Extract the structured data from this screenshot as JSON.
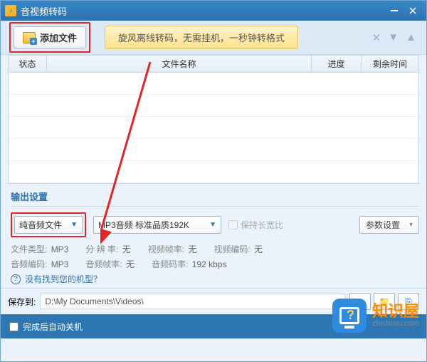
{
  "titlebar": {
    "title": "音视频转码"
  },
  "toolbar": {
    "add_label": "添加文件",
    "banner": "旋风离线转码，无需挂机，一秒钟转格式"
  },
  "table": {
    "headers": {
      "status": "状态",
      "name": "文件名称",
      "progress": "进度",
      "remain": "剩余时间"
    }
  },
  "output": {
    "section_title": "输出设置",
    "type_select": "纯音频文件",
    "format_select": "MP3音频 标准品质192K",
    "keep_ratio": "保持长宽比",
    "param_btn": "参数设置",
    "meta": {
      "file_type_lbl": "文件类型:",
      "file_type": "MP3",
      "resolution_lbl": "分 辨 率:",
      "resolution": "无",
      "vfps_lbl": "视频帧率:",
      "vfps": "无",
      "vcodec_lbl": "视频编码:",
      "vcodec": "无",
      "acodec_lbl": "音频编码:",
      "acodec": "MP3",
      "afps_lbl": "音频帧率:",
      "afps": "无",
      "abitrate_lbl": "音频码率:",
      "abitrate": "192 kbps"
    },
    "help": "没有找到您的机型？"
  },
  "save": {
    "label": "保存到:",
    "path": "D:\\My Documents\\Videos\\"
  },
  "footer": {
    "auto_shutdown": "完成后自动关机"
  },
  "watermark": {
    "cn": "知识屋",
    "en": "zhishiwu.com"
  }
}
